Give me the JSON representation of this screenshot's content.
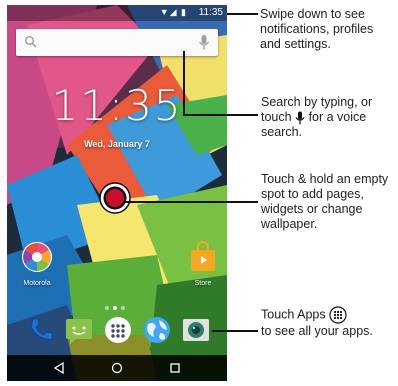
{
  "status_bar": {
    "time": "11:35",
    "icons": "▼◢ ▮"
  },
  "search": {
    "placeholder": ""
  },
  "lock": {
    "clock": "11:35",
    "date": "Wed, January 7"
  },
  "apps": {
    "motorola": "Motorola",
    "store": "Store"
  },
  "callouts": {
    "notifications": "Swipe down to see notifications, profiles and settings.",
    "search_part1": "Search by typing, or touch",
    "search_part2": "for a voice search.",
    "touch_hold": "Touch & hold an empty spot to add pages, widgets or change wallpaper.",
    "apps_part1": "Touch Apps",
    "apps_part2": "to see all your apps."
  },
  "colors": {
    "accent_red": "#c8102e",
    "nav_bar": "#000000",
    "chalk_blue": "#2a8fd6",
    "chalk_green": "#7ac143",
    "chalk_yellow": "#f2e46b",
    "chalk_pink": "#e94e77"
  },
  "icons": [
    "search-icon",
    "mic-icon",
    "wifi-icon",
    "signal-icon",
    "battery-icon",
    "phone-icon",
    "messaging-icon",
    "apps-icon",
    "browser-icon",
    "camera-icon",
    "back-icon",
    "home-icon",
    "recents-icon"
  ]
}
